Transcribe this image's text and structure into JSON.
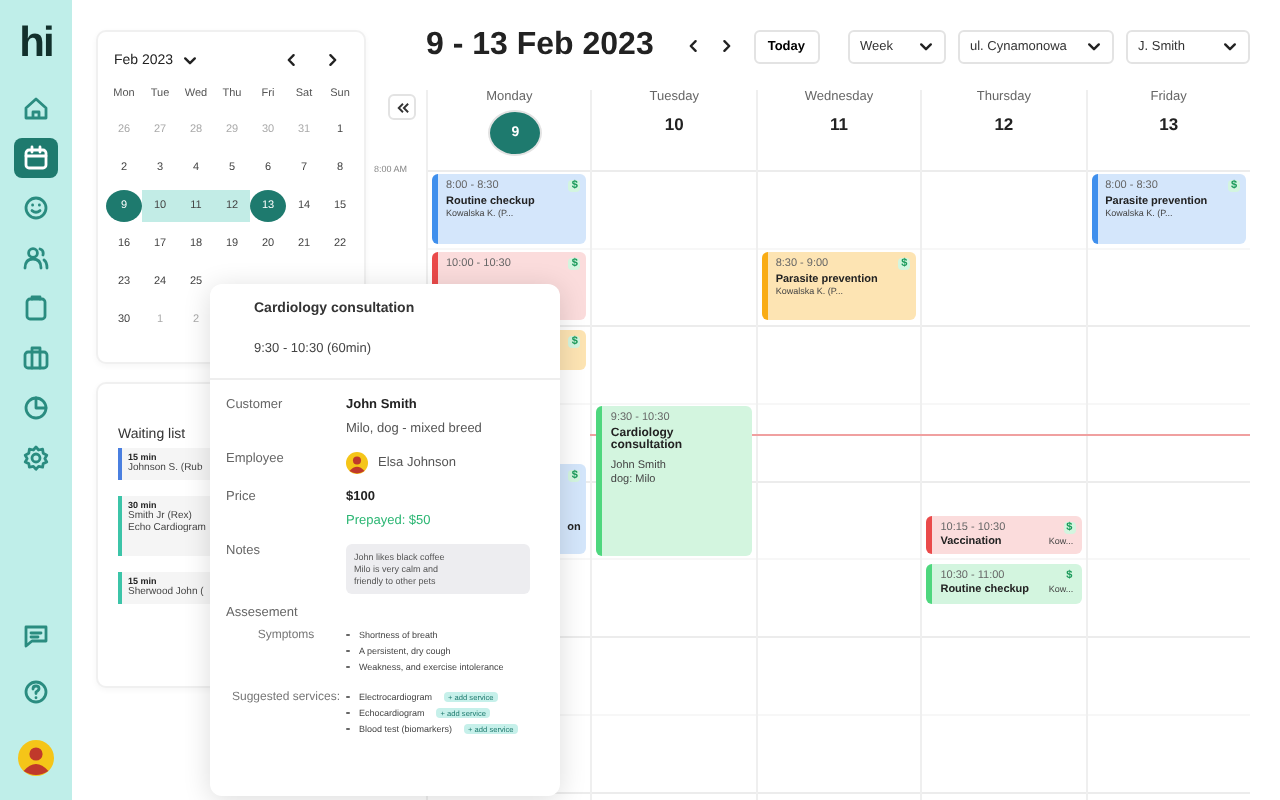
{
  "sidebar": {
    "logo": "hi",
    "items": [
      {
        "kind": "home",
        "selected": false
      },
      {
        "kind": "calendar",
        "selected": true
      },
      {
        "kind": "smiley",
        "selected": false
      },
      {
        "kind": "users",
        "selected": false
      },
      {
        "kind": "clipboard",
        "selected": false
      },
      {
        "kind": "briefcase",
        "selected": false
      },
      {
        "kind": "chart",
        "selected": false
      },
      {
        "kind": "gear",
        "selected": false
      }
    ],
    "bottom_items": [
      {
        "kind": "chat"
      },
      {
        "kind": "help"
      }
    ]
  },
  "mini_calendar": {
    "month": "Feb 2023",
    "weekdays": [
      "Mon",
      "Tue",
      "Wed",
      "Thu",
      "Fri",
      "Sat",
      "Sun"
    ],
    "weeks": [
      [
        {
          "day": "26",
          "muted": true,
          "in_range": false,
          "selected": false
        },
        {
          "day": "27",
          "muted": true,
          "in_range": false,
          "selected": false
        },
        {
          "day": "28",
          "muted": true,
          "in_range": false,
          "selected": false
        },
        {
          "day": "29",
          "muted": true,
          "in_range": false,
          "selected": false
        },
        {
          "day": "30",
          "muted": true,
          "in_range": false,
          "selected": false
        },
        {
          "day": "31",
          "muted": true,
          "in_range": false,
          "selected": false
        },
        {
          "day": "1",
          "muted": false,
          "in_range": false,
          "selected": false
        }
      ],
      [
        {
          "day": "2",
          "muted": false,
          "in_range": false,
          "selected": false
        },
        {
          "day": "3",
          "muted": false,
          "in_range": false,
          "selected": false
        },
        {
          "day": "4",
          "muted": false,
          "in_range": false,
          "selected": false
        },
        {
          "day": "5",
          "muted": false,
          "in_range": false,
          "selected": false
        },
        {
          "day": "6",
          "muted": false,
          "in_range": false,
          "selected": false
        },
        {
          "day": "7",
          "muted": false,
          "in_range": false,
          "selected": false
        },
        {
          "day": "8",
          "muted": false,
          "in_range": false,
          "selected": false
        }
      ],
      [
        {
          "day": "9",
          "muted": false,
          "in_range": true,
          "selected": true
        },
        {
          "day": "10",
          "muted": false,
          "in_range": true,
          "selected": false
        },
        {
          "day": "11",
          "muted": false,
          "in_range": true,
          "selected": false
        },
        {
          "day": "12",
          "muted": false,
          "in_range": true,
          "selected": false
        },
        {
          "day": "13",
          "muted": false,
          "in_range": true,
          "selected": true
        },
        {
          "day": "14",
          "muted": false,
          "in_range": false,
          "selected": false
        },
        {
          "day": "15",
          "muted": false,
          "in_range": false,
          "selected": false
        }
      ],
      [
        {
          "day": "16",
          "muted": false,
          "in_range": false,
          "selected": false
        },
        {
          "day": "17",
          "muted": false,
          "in_range": false,
          "selected": false
        },
        {
          "day": "18",
          "muted": false,
          "in_range": false,
          "selected": false
        },
        {
          "day": "19",
          "muted": false,
          "in_range": false,
          "selected": false
        },
        {
          "day": "20",
          "muted": false,
          "in_range": false,
          "selected": false
        },
        {
          "day": "21",
          "muted": false,
          "in_range": false,
          "selected": false
        },
        {
          "day": "22",
          "muted": false,
          "in_range": false,
          "selected": false
        }
      ],
      [
        {
          "day": "23",
          "muted": false,
          "in_range": false,
          "selected": false
        },
        {
          "day": "24",
          "muted": false,
          "in_range": false,
          "selected": false
        },
        {
          "day": "25",
          "muted": false,
          "in_range": false,
          "selected": false
        }
      ],
      [
        {
          "day": "30",
          "muted": false,
          "in_range": false,
          "selected": false
        },
        {
          "day": "1",
          "muted": true,
          "in_range": false,
          "selected": false
        },
        {
          "day": "2",
          "muted": true,
          "in_range": false,
          "selected": false
        }
      ]
    ]
  },
  "waiting_list": {
    "title": "Waiting list",
    "items": [
      {
        "duration": "15 min",
        "lines": [
          "Johnson S. (Rub"
        ],
        "color": "#4a7fe0"
      },
      {
        "duration": "30 min",
        "lines": [
          "Smith Jr (Rex)",
          "Echo Cardiogram"
        ],
        "color": "#3cc4a8"
      },
      {
        "duration": "15 min",
        "lines": [
          "Sherwood John ("
        ],
        "color": "#3cc4a8"
      }
    ]
  },
  "calendar": {
    "range_title": "9 - 13 Feb 2023",
    "today_button": "Today",
    "filters": [
      "Week",
      "ul. Cynamonowa",
      "J. Smith"
    ],
    "time_labels": [
      "8:00 AM"
    ],
    "days": [
      {
        "name": "Monday",
        "date": "9",
        "today": true,
        "events": [
          {
            "kind": "normal",
            "time": "8:00 - 8:30",
            "title": "Routine checkup",
            "lines": [
              "Kowalska K. (P..."
            ],
            "badge": "$",
            "color": "#d4e6fb"
          },
          {
            "kind": "normal",
            "time": "10:00 - 10:30",
            "badge": "$",
            "color": "#fbdcdc"
          },
          {
            "kind": "clipped",
            "badge": "$",
            "color": "#fde4b3"
          },
          {
            "kind": "clipped",
            "title": "on",
            "badge": "$",
            "color": "#d4e6fb"
          }
        ]
      },
      {
        "name": "Tuesday",
        "date": "10",
        "today": false,
        "events": [
          {
            "kind": "normal",
            "time": "9:30 - 10:30",
            "title": "Cardiology consultation",
            "lines": [
              "John Smith",
              "dog: Milo"
            ],
            "color": "#d3f5df"
          }
        ]
      },
      {
        "name": "Wednesday",
        "date": "11",
        "today": false,
        "events": [
          {
            "kind": "normal",
            "time": "8:30 - 9:00",
            "title": "Parasite prevention",
            "lines": [
              "Kowalska K. (P..."
            ],
            "badge": "$",
            "color": "#fde4b3"
          }
        ]
      },
      {
        "name": "Thursday",
        "date": "12",
        "today": false,
        "events": [
          {
            "kind": "short",
            "time": "10:15 - 10:30",
            "title": "Vaccination",
            "lines": [
              "Kow..."
            ],
            "badge": "$",
            "color": "#fbdcdc"
          },
          {
            "kind": "short",
            "time": "10:30 - 11:00",
            "title": "Routine checkup",
            "lines": [
              "Kow..."
            ],
            "badge": "$",
            "color": "#d3f5df"
          }
        ]
      },
      {
        "name": "Friday",
        "date": "13",
        "today": false,
        "events": [
          {
            "kind": "normal",
            "time": "8:00 - 8:30",
            "title": "Parasite prevention",
            "lines": [
              "Kowalska K. (P..."
            ],
            "badge": "$",
            "color": "#d4e6fb"
          }
        ]
      }
    ]
  },
  "popup": {
    "title": "Cardiology consultation",
    "time": "9:30 - 10:30 (60min)",
    "fields": [
      {
        "kind": "customer",
        "label": "Customer",
        "values": [
          "John Smith",
          "Milo, dog - mixed breed"
        ]
      },
      {
        "kind": "employee",
        "label": "Employee",
        "values": [
          "Elsa Johnson"
        ]
      },
      {
        "kind": "price",
        "label": "Price",
        "values": [
          "$100",
          "Prepayed: $50"
        ]
      },
      {
        "kind": "notes",
        "label": "Notes",
        "values": [
          "John likes black coffee",
          "Milo is very calm and",
          "friendly to other pets"
        ]
      }
    ],
    "assessment": {
      "title": "Assesement",
      "symptoms": {
        "label": "Symptoms",
        "items": [
          "Shortness of breath",
          "A persistent, dry cough",
          "Weakness, and exercise intolerance"
        ]
      },
      "services": {
        "label": "Suggested services:",
        "items": [
          {
            "name": "Electrocardiogram",
            "tag": "+ add service"
          },
          {
            "name": "Echocardiogram",
            "tag": "+ add service"
          },
          {
            "name": "Blood test (biomarkers)",
            "tag": "+ add service"
          }
        ]
      }
    }
  }
}
